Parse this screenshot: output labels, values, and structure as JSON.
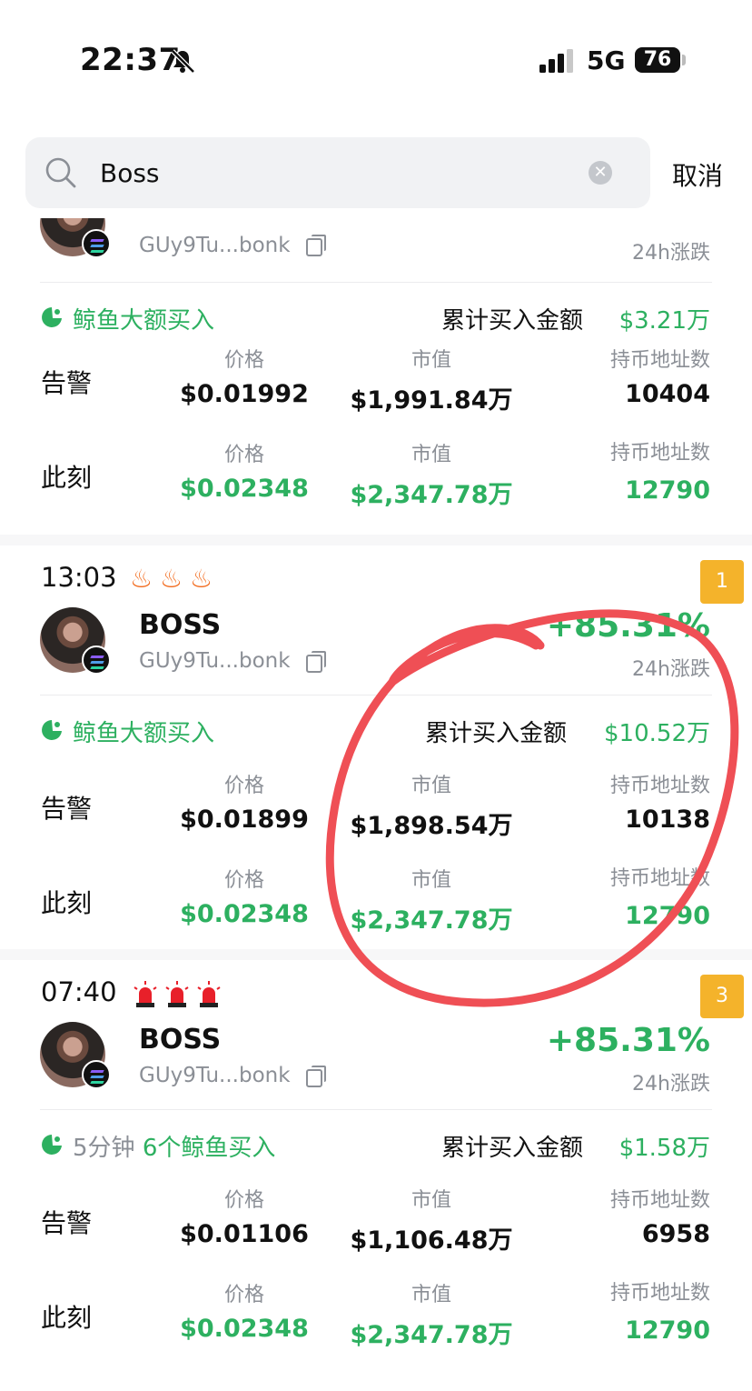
{
  "status": {
    "time": "22:37",
    "network": "5G",
    "battery": "76"
  },
  "search": {
    "value": "Boss",
    "cancel_label": "取消"
  },
  "alerts": [
    {
      "time": "",
      "rank": "",
      "token_address": "GUy9Tu...bonk",
      "change_label": "24h涨跌",
      "whale_label": "鲸鱼大额买入",
      "cum_buy_label": "累计买入金额",
      "cum_buy_value": "$3.21万",
      "alert_row_label": "告警",
      "now_row_label": "此刻",
      "price_label": "价格",
      "mcap_label": "市值",
      "holders_label": "持币地址数",
      "alert_price": "$0.01992",
      "alert_mcap": "$1,991.84万",
      "alert_holders": "10404",
      "now_price": "$0.02348",
      "now_mcap": "$2,347.78万",
      "now_holders": "12790"
    },
    {
      "time": "13:03",
      "rank": "1",
      "token_name": "BOSS",
      "token_address": "GUy9Tu...bonk",
      "change": "+85.31%",
      "change_label": "24h涨跌",
      "whale_label": "鲸鱼大额买入",
      "cum_buy_label": "累计买入金额",
      "cum_buy_value": "$10.52万",
      "alert_row_label": "告警",
      "now_row_label": "此刻",
      "price_label": "价格",
      "mcap_label": "市值",
      "holders_label": "持币地址数",
      "alert_price": "$0.01899",
      "alert_mcap": "$1,898.54万",
      "alert_holders": "10138",
      "now_price": "$0.02348",
      "now_mcap": "$2,347.78万",
      "now_holders": "12790"
    },
    {
      "time": "07:40",
      "rank": "3",
      "token_name": "BOSS",
      "token_address": "GUy9Tu...bonk",
      "change": "+85.31%",
      "change_label": "24h涨跌",
      "whale_time_label": "5分钟",
      "whale_label": "6个鲸鱼买入",
      "cum_buy_label": "累计买入金额",
      "cum_buy_value": "$1.58万",
      "alert_row_label": "告警",
      "now_row_label": "此刻",
      "price_label": "价格",
      "mcap_label": "市值",
      "holders_label": "持币地址数",
      "alert_price": "$0.01106",
      "alert_mcap": "$1,106.48万",
      "alert_holders": "6958",
      "now_price": "$0.02348",
      "now_mcap": "$2,347.78万",
      "now_holders": "12790"
    }
  ],
  "colors": {
    "green": "#2db060",
    "gray": "#8b8f96",
    "rank_badge": "#f4b32b",
    "annotation": "#ef4f55"
  },
  "icons": [
    "bell-slash-icon",
    "signal-icon",
    "search-icon",
    "clear-icon",
    "copy-icon",
    "solana-badge-icon",
    "whale-icon",
    "fire-icon",
    "siren-icon"
  ]
}
